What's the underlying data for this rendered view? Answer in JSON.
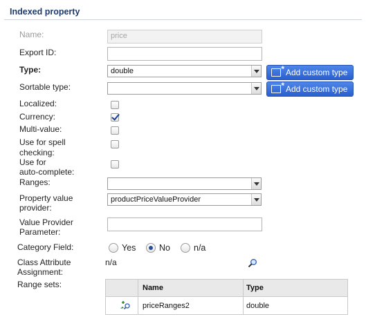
{
  "panel": {
    "title": "Indexed property"
  },
  "fields": {
    "name": {
      "label": "Name:",
      "value": "price"
    },
    "export_id": {
      "label": "Export ID:",
      "value": ""
    },
    "type": {
      "label": "Type:",
      "value": "double"
    },
    "sortable_type": {
      "label": "Sortable type:",
      "value": ""
    },
    "localized": {
      "label": "Localized:",
      "checked": false
    },
    "currency": {
      "label": "Currency:",
      "checked": true
    },
    "multi_value": {
      "label": "Multi-value:",
      "checked": false
    },
    "spell_checking": {
      "label_line1": "Use for spell",
      "label_line2": "checking:",
      "checked": false
    },
    "auto_complete": {
      "label_line1": "Use for",
      "label_line2": "auto-complete:",
      "checked": false
    },
    "ranges": {
      "label": "Ranges:",
      "value": ""
    },
    "property_value_provider": {
      "label_line1": "Property value",
      "label_line2": "provider:",
      "value": "productPriceValueProvider"
    },
    "value_provider_parameter": {
      "label_line1": "Value Provider",
      "label_line2": "Parameter:",
      "value": ""
    },
    "category_field": {
      "label": "Category Field:",
      "options": [
        "Yes",
        "No",
        "n/a"
      ],
      "selected": "No"
    },
    "class_attribute_assignment": {
      "label_line1": "Class Attribute",
      "label_line2": "Assignment:",
      "value": "n/a"
    },
    "range_sets": {
      "label": "Range sets:",
      "columns": [
        "Name",
        "Type"
      ],
      "rows": [
        {
          "name": "priceRanges2",
          "type": "double"
        }
      ]
    }
  },
  "buttons": {
    "add_custom_type": "Add custom type"
  },
  "colors": {
    "accent": "#2a5fcf",
    "title": "#1e3a6b"
  },
  "icons": {
    "add_custom_type": "add-custom-type-icon",
    "search": "search-icon",
    "edit": "edit-icon"
  }
}
